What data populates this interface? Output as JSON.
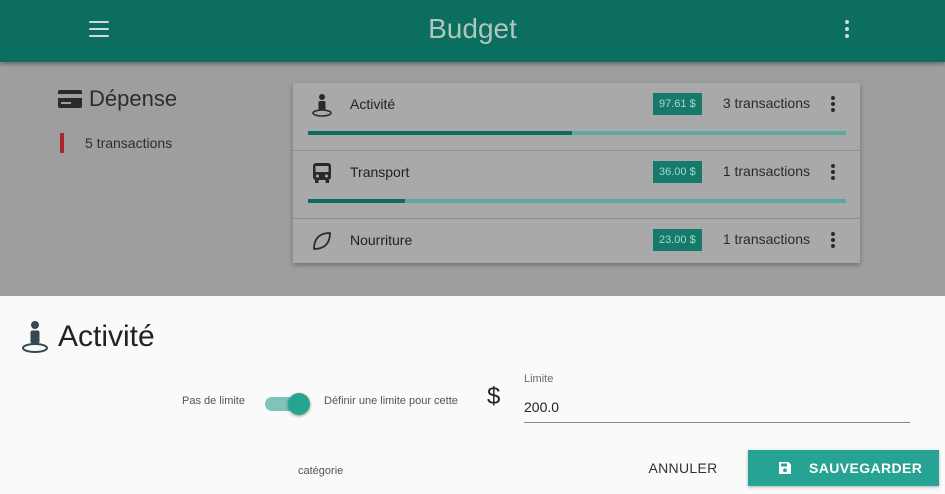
{
  "app": {
    "title": "Budget"
  },
  "depense": {
    "title": "Dépense",
    "transaction_count": "5 transactions",
    "marker_color": "#a8262f"
  },
  "categories": [
    {
      "name": "Activité",
      "icon": "person-pin-icon",
      "amount": "97.61 $",
      "transactions": "3 transactions",
      "progress": 0.49
    },
    {
      "name": "Transport",
      "icon": "bus-icon",
      "amount": "36.00 $",
      "transactions": "1 transactions",
      "progress": 0.18
    },
    {
      "name": "Nourriture",
      "icon": "leaf-icon",
      "amount": "23.00 $",
      "transactions": "1 transactions"
    }
  ],
  "sheet": {
    "title": "Activité",
    "toggle_off_label": "Pas de limite",
    "toggle_on_label_line1": "Définir une limite pour cette",
    "toggle_on_label_line2": "catégorie",
    "toggle_state": "on",
    "currency_symbol": "$",
    "limit_label": "Limite",
    "limit_value": "200.0",
    "cancel_label": "ANNULER",
    "save_label": "SAUVEGARDER"
  },
  "colors": {
    "appbar": "#0b6e5e",
    "accent": "#26a393",
    "badge": "#167a6b"
  }
}
